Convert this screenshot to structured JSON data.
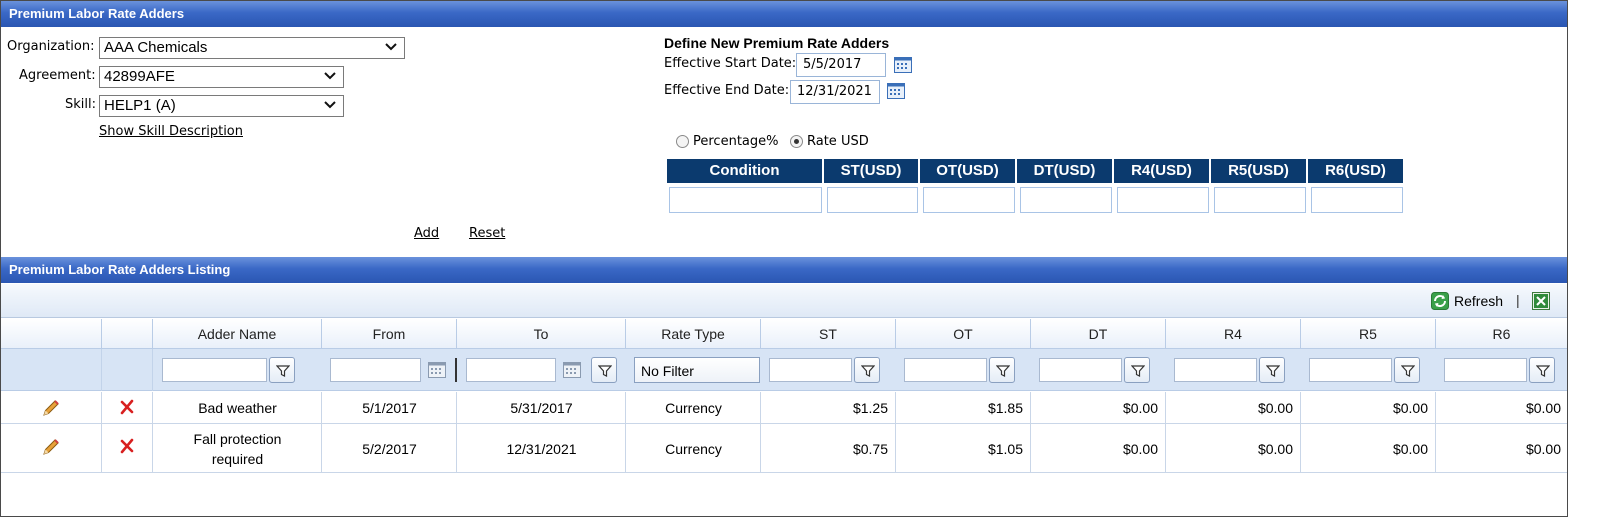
{
  "panel_title": "Premium Labor Rate Adders",
  "form": {
    "organization_label": "Organization:",
    "organization_value": "AAA Chemicals",
    "agreement_label": "Agreement:",
    "agreement_value": "42899AFE",
    "skill_label": "Skill:",
    "skill_value": "HELP1 (A)",
    "show_skill_link": "Show Skill Description",
    "add_link": "Add",
    "reset_link": "Reset"
  },
  "define": {
    "heading": "Define New Premium Rate Adders",
    "start_label": "Effective Start Date:",
    "start_value": "5/5/2017",
    "end_label": "Effective End Date:",
    "end_value": "12/31/2021",
    "radio_percentage": "Percentage%",
    "radio_rate": "Rate USD",
    "selected": "Rate USD",
    "rate_columns": [
      "Condition",
      "ST(USD)",
      "OT(USD)",
      "DT(USD)",
      "R4(USD)",
      "R5(USD)",
      "R6(USD)"
    ]
  },
  "listing": {
    "title": "Premium Labor Rate Adders Listing",
    "refresh_label": "Refresh",
    "toolbar_separator": "|",
    "columns": [
      "",
      "",
      "Adder Name",
      "From",
      "To",
      "Rate Type",
      "ST",
      "OT",
      "DT",
      "R4",
      "R5",
      "R6"
    ],
    "rate_type_filter": "No Filter",
    "rows": [
      {
        "name_line1": "Bad weather",
        "name_line2": "",
        "from": "5/1/2017",
        "to": "5/31/2017",
        "rate_type": "Currency",
        "st": "$1.25",
        "ot": "$1.85",
        "dt": "$0.00",
        "r4": "$0.00",
        "r5": "$0.00",
        "r6": "$0.00"
      },
      {
        "name_line1": "Fall protection",
        "name_line2": "required",
        "from": "5/2/2017",
        "to": "12/31/2021",
        "rate_type": "Currency",
        "st": "$0.75",
        "ot": "$1.05",
        "dt": "$0.00",
        "r4": "$0.00",
        "r5": "$0.00",
        "r6": "$0.00"
      }
    ]
  },
  "colors": {
    "title_bar": "#3a68c6",
    "rate_header": "#0b3a6e",
    "filter_row": "#d7e4f5"
  }
}
